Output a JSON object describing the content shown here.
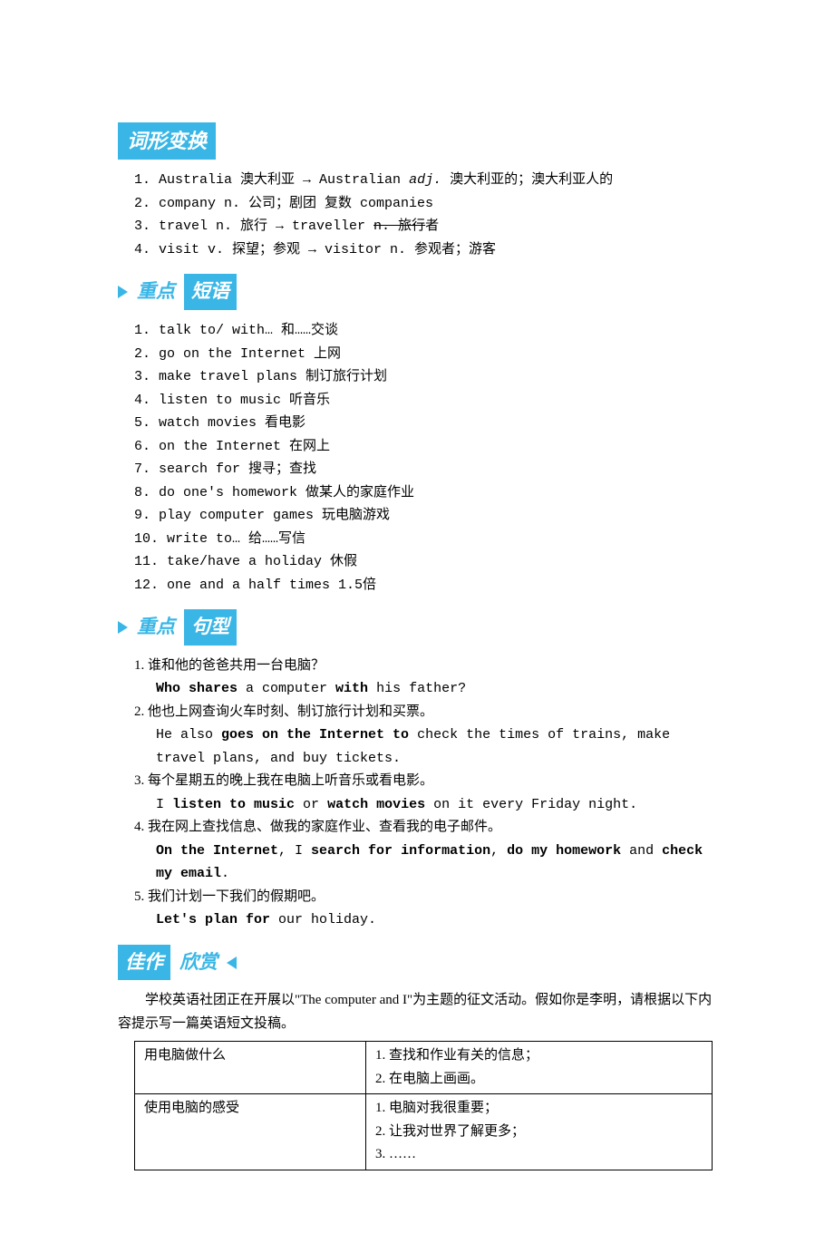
{
  "headings": {
    "h1": "词形变换",
    "h2a": "重点",
    "h2b": "短语",
    "h3a": "重点",
    "h3b": "句型",
    "h4a": "佳作",
    "h4b": "欣赏"
  },
  "forms": {
    "r1_num": "1. ",
    "r1_a": "Australia 澳大利亚 → Australian ",
    "r1_adj": "adj.",
    "r1_b": " 澳大利亚的；澳大利亚人的",
    "r2": "2. company  n. 公司；剧团 复数  companies",
    "r3_a": "3. travel  n. 旅行 → traveller  ",
    "r3_s": "n. 旅行",
    "r3_b": "者",
    "r4": "4. visit  v. 探望；参观 → visitor  n. 参观者；游客"
  },
  "phrases": {
    "p1": "1. talk to/ with… 和……交谈",
    "p2": "2. go on the Internet 上网",
    "p3": "3. make travel plans 制订旅行计划",
    "p4": "4. listen to music 听音乐",
    "p5": "5. watch movies 看电影",
    "p6": "6. on the Internet 在网上",
    "p7": "7. search for  搜寻；查找",
    "p8": "8. do one's homework 做某人的家庭作业",
    "p9": "9. play computer games 玩电脑游戏",
    "p10": "10. write to…  给……写信",
    "p11": "11. take/have a holiday 休假",
    "p12": "12. one and a half times  1.5倍"
  },
  "sentences": {
    "s1_cn": "1. 谁和他的爸爸共用一台电脑？",
    "s1_a": "Who shares",
    "s1_b": " a computer ",
    "s1_c": "with",
    "s1_d": " his father?",
    "s2_cn": "2. 他也上网查询火车时刻、制订旅行计划和买票。",
    "s2_a": "He also ",
    "s2_b": "goes on the Internet to",
    "s2_c": " check the times of trains, make travel plans, and buy tickets.",
    "s3_cn": "3. 每个星期五的晚上我在电脑上听音乐或看电影。",
    "s3_a": "I ",
    "s3_b": "listen to music",
    "s3_c": " or ",
    "s3_d": "watch movies",
    "s3_e": " on it every Friday night.",
    "s4_cn": "4. 我在网上查找信息、做我的家庭作业、查看我的电子邮件。",
    "s4_a": "On the Internet",
    "s4_b": ", I ",
    "s4_c": "search for information",
    "s4_d": ", ",
    "s4_e": "do my homework",
    "s4_f": " and ",
    "s4_g": "check my email",
    "s4_h": ".",
    "s5_cn": "5. 我们计划一下我们的假期吧。",
    "s5_a": "Let's plan for",
    "s5_b": " our holiday."
  },
  "essay": {
    "intro": "学校英语社团正在开展以\"The computer and I\"为主题的征文活动。假如你是李明，请根据以下内容提示写一篇英语短文投稿。",
    "r1c1": "用电脑做什么",
    "r1c2a": "1. 查找和作业有关的信息；",
    "r1c2b": "2. 在电脑上画画。",
    "r2c1": "使用电脑的感受",
    "r2c2a": "1. 电脑对我很重要；",
    "r2c2b": "2. 让我对世界了解更多；",
    "r2c2c": "3. ……"
  }
}
